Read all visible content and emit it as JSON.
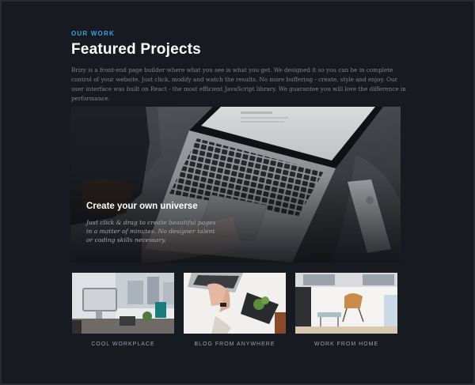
{
  "header": {
    "eyebrow": "OUR WORK",
    "title": "Featured Projects",
    "description": "Brizy is a front-end page builder where what you see is what you get. We designed it so you can be in complete control of your website. Just click, modify and watch the results. No more buffering - create, style and enjoy. Our user interface was built on React - the most efficient JavaScript library. We guarantee you will love the difference in performance."
  },
  "hero": {
    "title": "Create your own universe",
    "text": "Just click & drag to create beautiful pages in a matter of minutes. No designer talent or coding skills necessary."
  },
  "cards": [
    {
      "label": "COOL WORKPLACE"
    },
    {
      "label": "BLOG FROM ANYWHERE"
    },
    {
      "label": "WORK FROM HOME"
    }
  ],
  "colors": {
    "background": "#181a22",
    "accent": "#39a3e6",
    "heading": "#ffffff",
    "body_text": "#7d8190"
  }
}
